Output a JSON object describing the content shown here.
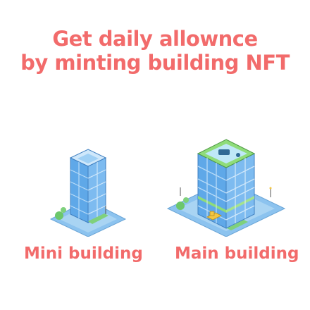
{
  "headline": {
    "line1": "Get daily allownce",
    "line2": "by minting building NFT"
  },
  "buildings": [
    {
      "label": "Mini building"
    },
    {
      "label": "Main building"
    }
  ],
  "colors": {
    "text": "#f26b6b",
    "ground": "#8cc3ef",
    "glass": "#5fa8e8",
    "roof_trim": "#8fdc7a"
  }
}
